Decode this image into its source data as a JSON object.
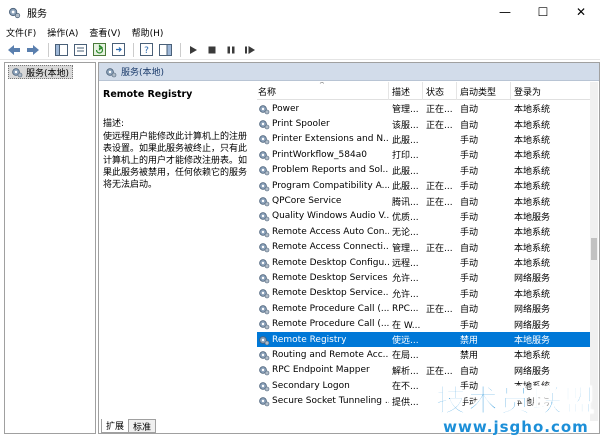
{
  "window": {
    "title": "服务",
    "icon": "gear-icon",
    "controls": {
      "minimize": "—",
      "maximize": "☐",
      "close": "✕"
    }
  },
  "menu": [
    "文件(F)",
    "操作(A)",
    "查看(V)",
    "帮助(H)"
  ],
  "toolbar": {
    "buttons": [
      "back-icon",
      "forward-icon",
      "console-tree-icon",
      "properties-icon",
      "refresh-icon",
      "export-icon",
      "help-icon",
      "show-hide-icon",
      "play-icon",
      "stop-icon",
      "pause-icon",
      "restart-icon"
    ]
  },
  "tree": {
    "selected_label": "服务(本地)"
  },
  "panel": {
    "header": "服务(本地)",
    "selected_service_name": "Remote Registry",
    "description_label": "描述:",
    "description_text": "使远程用户能修改此计算机上的注册表设置。如果此服务被终止，只有此计算机上的用户才能修改注册表。如果此服务被禁用，任何依赖它的服务将无法启动。"
  },
  "table": {
    "columns": [
      "名称",
      "描述",
      "状态",
      "启动类型",
      "登录为"
    ],
    "rows": [
      {
        "name": "Power",
        "desc": "管理...",
        "status": "正在...",
        "start": "自动",
        "logon": "本地系统",
        "selected": false
      },
      {
        "name": "Print Spooler",
        "desc": "该服...",
        "status": "正在...",
        "start": "自动",
        "logon": "本地系统",
        "selected": false
      },
      {
        "name": "Printer Extensions and N...",
        "desc": "此服...",
        "status": "",
        "start": "手动",
        "logon": "本地系统",
        "selected": false
      },
      {
        "name": "PrintWorkflow_584a0",
        "desc": "打印...",
        "status": "",
        "start": "手动",
        "logon": "本地系统",
        "selected": false
      },
      {
        "name": "Problem Reports and Sol...",
        "desc": "此服...",
        "status": "",
        "start": "手动",
        "logon": "本地系统",
        "selected": false
      },
      {
        "name": "Program Compatibility A...",
        "desc": "此服...",
        "status": "正在...",
        "start": "手动",
        "logon": "本地系统",
        "selected": false
      },
      {
        "name": "QPCore Service",
        "desc": "腾讯...",
        "status": "正在...",
        "start": "自动",
        "logon": "本地系统",
        "selected": false
      },
      {
        "name": "Quality Windows Audio V...",
        "desc": "优质...",
        "status": "",
        "start": "手动",
        "logon": "本地服务",
        "selected": false
      },
      {
        "name": "Remote Access Auto Con...",
        "desc": "无论...",
        "status": "",
        "start": "手动",
        "logon": "本地系统",
        "selected": false
      },
      {
        "name": "Remote Access Connecti...",
        "desc": "管理...",
        "status": "正在...",
        "start": "自动",
        "logon": "本地系统",
        "selected": false
      },
      {
        "name": "Remote Desktop Configu...",
        "desc": "远程...",
        "status": "",
        "start": "手动",
        "logon": "本地系统",
        "selected": false
      },
      {
        "name": "Remote Desktop Services",
        "desc": "允许...",
        "status": "",
        "start": "手动",
        "logon": "网络服务",
        "selected": false
      },
      {
        "name": "Remote Desktop Service...",
        "desc": "允许...",
        "status": "",
        "start": "手动",
        "logon": "本地系统",
        "selected": false
      },
      {
        "name": "Remote Procedure Call (...",
        "desc": "RPC...",
        "status": "正在...",
        "start": "自动",
        "logon": "网络服务",
        "selected": false
      },
      {
        "name": "Remote Procedure Call (...",
        "desc": "在 W...",
        "status": "",
        "start": "手动",
        "logon": "网络服务",
        "selected": false
      },
      {
        "name": "Remote Registry",
        "desc": "使远...",
        "status": "",
        "start": "禁用",
        "logon": "本地服务",
        "selected": true
      },
      {
        "name": "Routing and Remote Acc...",
        "desc": "在局...",
        "status": "",
        "start": "禁用",
        "logon": "本地系统",
        "selected": false
      },
      {
        "name": "RPC Endpoint Mapper",
        "desc": "解析...",
        "status": "正在...",
        "start": "自动",
        "logon": "网络服务",
        "selected": false
      },
      {
        "name": "Secondary Logon",
        "desc": "在不...",
        "status": "",
        "start": "手动",
        "logon": "本地系统",
        "selected": false
      },
      {
        "name": "Secure Socket Tunneling ...",
        "desc": "提供...",
        "status": "",
        "start": "手动",
        "logon": "本地服务",
        "selected": false
      }
    ]
  },
  "bottom_tabs": [
    "扩展",
    "标准"
  ],
  "watermark": {
    "text": "技术员联盟",
    "url": "www.jsgho.com"
  },
  "colors": {
    "selection": "#0078d7",
    "panel_header": "#d2dcea",
    "watermark": "#1c8fd8"
  }
}
